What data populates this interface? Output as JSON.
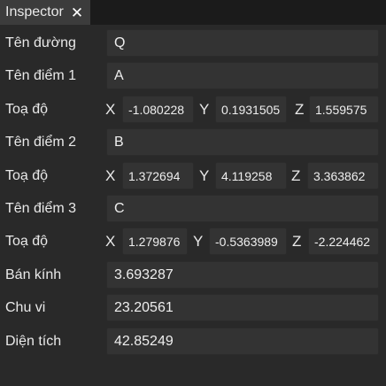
{
  "tab": {
    "title": "Inspector",
    "close_glyph": "✕"
  },
  "rows": {
    "ten_duong": {
      "label": "Tên đường",
      "value": "Q"
    },
    "ten_diem_1": {
      "label": "Tên điểm 1",
      "value": "A"
    },
    "toa_do_1": {
      "label": "Toạ độ",
      "x_label": "X",
      "y_label": "Y",
      "z_label": "Z",
      "x": "-1.080228",
      "y": "0.1931505",
      "z": "1.559575"
    },
    "ten_diem_2": {
      "label": "Tên điểm 2",
      "value": "B"
    },
    "toa_do_2": {
      "label": "Toạ độ",
      "x_label": "X",
      "y_label": "Y",
      "z_label": "Z",
      "x": "1.372694",
      "y": "4.119258",
      "z": "3.363862"
    },
    "ten_diem_3": {
      "label": "Tên điểm 3",
      "value": "C"
    },
    "toa_do_3": {
      "label": "Toạ độ",
      "x_label": "X",
      "y_label": "Y",
      "z_label": "Z",
      "x": "1.279876",
      "y": "-0.5363989",
      "z": "-2.224462"
    },
    "ban_kinh": {
      "label": "Bán kính",
      "value": "3.693287"
    },
    "chu_vi": {
      "label": "Chu vi",
      "value": "23.20561"
    },
    "dien_tich": {
      "label": "Diện tích",
      "value": "42.85249"
    }
  },
  "colors": {
    "background": "#292929",
    "field": "#333333",
    "tab": "#3c3c3c",
    "text": "#e9e9e9"
  }
}
